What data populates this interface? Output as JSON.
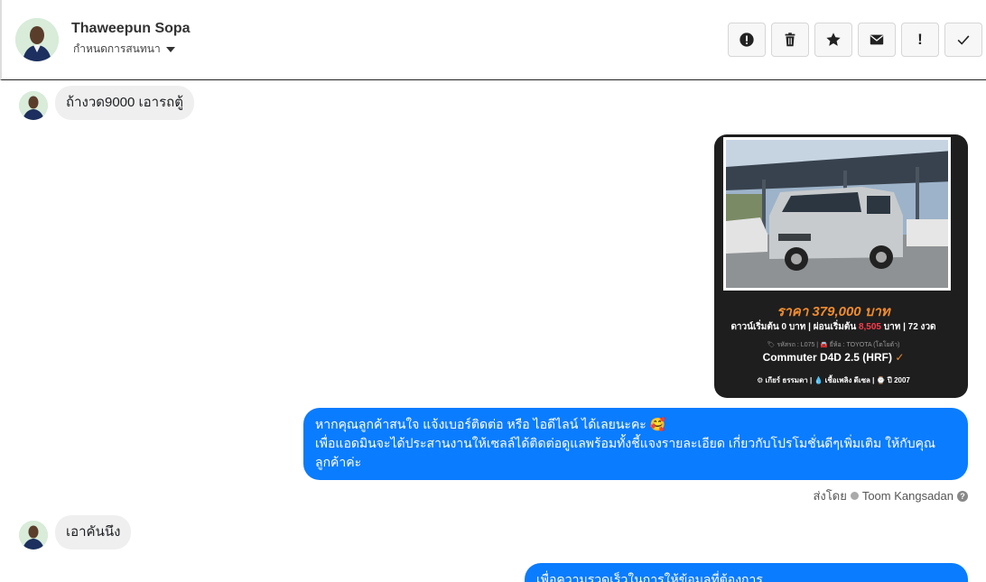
{
  "header": {
    "contact_name": "Thaweepun Sopa",
    "subtitle": "กำหนดการสนทนา",
    "actions": [
      {
        "icon": "alert-circle-icon",
        "label": ""
      },
      {
        "icon": "trash-icon",
        "label": ""
      },
      {
        "icon": "star-icon",
        "label": ""
      },
      {
        "icon": "envelope-icon",
        "label": ""
      },
      {
        "icon": "exclamation-icon",
        "label": "!"
      },
      {
        "icon": "check-icon",
        "label": ""
      }
    ]
  },
  "messages": {
    "m1": {
      "direction": "incoming",
      "text": "ถ้างวด9000 เอารถตู้"
    },
    "card": {
      "price": "ราคา 379,000 บาท",
      "terms_prefix": "ดาวน์เริ่มต้น 0 บาท | ผ่อนเริ่มต้น ",
      "terms_monthly": "8,505",
      "terms_suffix": " บาท | 72 งวด",
      "meta": "🏷 รหัสรถ : L075 | 🚘 ยี่ห้อ : TOYOTA (โตโยต้า)",
      "model": "Commuter D4D 2.5 (HRF)",
      "model_check": "✓",
      "specs": "⚙ เกียร์ ธรรมดา | 💧 เชื้อเพลิง ดีเซล | ⌚ ปี 2007"
    },
    "m2": {
      "direction": "outgoing",
      "line1": "หากคุณลูกค้าสนใจ แจ้งเบอร์ติดต่อ หรือ ไอดีไลน์ ได้เลยนะคะ 🥰",
      "line2": "เพื่อแอดมินจะได้ประสานงานให้เซลล์ได้ติดต่อดูแลพร้อมทั้งชี้แจงรายละเอียด เกี่ยวกับโปรโมชั่นดีๆเพิ่มเติม ให้กับคุณลูกค้าค่ะ"
    },
    "sent_by": {
      "prefix": "ส่งโดย",
      "agent": "Toom Kangsadan",
      "help": "?"
    },
    "m3": {
      "direction": "incoming",
      "text": "เอาคันนึง"
    },
    "m4": {
      "direction": "outgoing",
      "text": "เพื่อความรวดเร็วในการให้ข้อมูลที่ต้องการ"
    }
  },
  "colors": {
    "outgoing_bubble": "#0a7cff",
    "incoming_bubble": "#efefef",
    "price_orange": "#f08c2e",
    "monthly_red": "#ff3c4c"
  }
}
